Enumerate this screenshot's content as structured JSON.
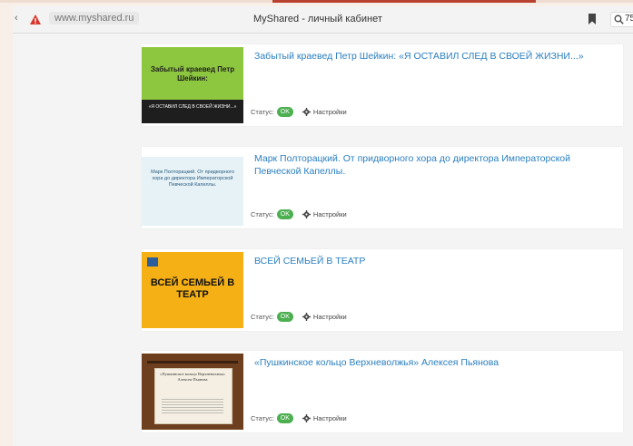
{
  "browser": {
    "url": "www.myshared.ru",
    "tab_title": "MyShared - личный кабинет",
    "zoom": "75"
  },
  "presentations": [
    {
      "title": "Забытый краевед Петр Шейкин: «Я ОСТАВИЛ СЛЕД В СВОЕЙ ЖИЗНИ...»",
      "status_label": "Статус:",
      "status_value": "OK",
      "settings_label": "Настройки",
      "thumb": {
        "big": "Забытый краевед Петр Шейкин:",
        "quote": "«Я ОСТАВИЛ СЛЕД В СВОЕЙ ЖИЗНИ...»"
      }
    },
    {
      "title": "Марк Полторацкий. От придворного хора до директора Императорской Певческой Капеллы.",
      "status_label": "Статус:",
      "status_value": "OK",
      "settings_label": "Настройки",
      "thumb": {
        "text": "Марк Полторацкий. От придворного хора до директора Императорской Певческой Капеллы."
      }
    },
    {
      "title": "ВСЕЙ СЕМЬЕЙ В ТЕАТР",
      "status_label": "Статус:",
      "status_value": "OK",
      "settings_label": "Настройки",
      "thumb": {
        "big": "ВСЕЙ СЕМЬЕЙ В ТЕАТР"
      }
    },
    {
      "title": "«Пушкинское кольцо Верхневолжья» Алексея Пьянова",
      "status_label": "Статус:",
      "status_value": "OK",
      "settings_label": "Настройки",
      "thumb": {
        "text": "«Пушкинское кольцо Верхневолжья» Алексея Пьянова"
      }
    }
  ],
  "colors": {
    "link": "#2a7fc0",
    "ok_badge": "#4caf50"
  }
}
